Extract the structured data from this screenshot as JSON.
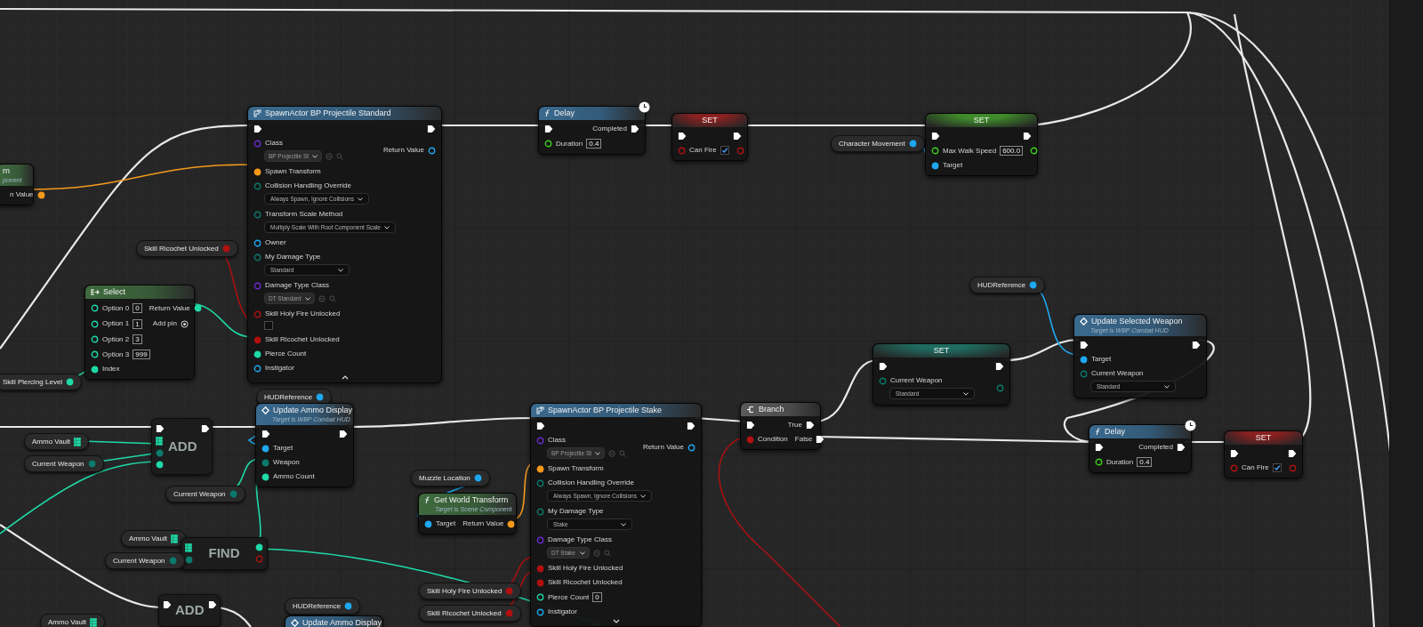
{
  "nodes": [
    {
      "kind": "fragment",
      "title": "rn",
      "subtitle": "ponent",
      "color": "#3f6b3f",
      "rows": [
        {
          "right": {
            "kind": "struct",
            "label": "n Value",
            "linked": true
          }
        }
      ]
    },
    {
      "kind": "spawn",
      "title": "SpawnActor BP Projectile Standard",
      "color": "#3a6a8f",
      "expanded": true,
      "rows": [
        {
          "left": {
            "kind": "exec",
            "linked": true
          },
          "right": {
            "kind": "exec",
            "linked": true
          }
        },
        {
          "left": {
            "kind": "class",
            "label": "Class",
            "linked": false,
            "dropdown": "BP Projectile St"
          },
          "right": {
            "kind": "object",
            "label": "Return Value",
            "linked": false
          }
        },
        {
          "left": {
            "kind": "struct",
            "label": "Spawn Transform",
            "linked": true
          }
        },
        {
          "left": {
            "kind": "byte",
            "label": "Collision Handling Override",
            "linked": false,
            "dropdown": "Always Spawn, Ignore Collisions"
          }
        },
        {
          "left": {
            "kind": "byte",
            "label": "Transform Scale Method",
            "linked": false,
            "dropdown": "Multiply Scale With Root Component Scale"
          }
        },
        {
          "left": {
            "kind": "object",
            "label": "Owner",
            "linked": false
          }
        },
        {
          "left": {
            "kind": "byte",
            "label": "My Damage Type",
            "linked": false,
            "dropdown": "Standard"
          }
        },
        {
          "left": {
            "kind": "class",
            "label": "Damage Type Class",
            "linked": false,
            "dropdown": "DT Standard"
          }
        },
        {
          "left": {
            "kind": "bool",
            "label": "Skill Holy Fire Unlocked",
            "linked": false,
            "checked": false
          }
        },
        {
          "left": {
            "kind": "bool",
            "label": "Skill Ricochet Unlocked",
            "linked": true
          }
        },
        {
          "left": {
            "kind": "int",
            "label": "Pierce Count",
            "linked": true
          }
        },
        {
          "left": {
            "kind": "object",
            "label": "Instigator",
            "linked": false
          }
        }
      ]
    },
    {
      "kind": "function",
      "title": "Delay",
      "color": "#3a6a8f",
      "latent": true,
      "rows": [
        {
          "left": {
            "kind": "exec",
            "linked": true
          },
          "right": {
            "kind": "exec",
            "label": "Completed",
            "linked": true
          }
        },
        {
          "left": {
            "kind": "float",
            "label": "Duration",
            "linked": false,
            "value": "0.4"
          }
        }
      ]
    },
    {
      "kind": "set",
      "title": "SET",
      "color": "#8a2020",
      "rows": [
        {
          "left": {
            "kind": "exec",
            "linked": true
          },
          "right": {
            "kind": "exec",
            "linked": true
          }
        },
        {
          "left": {
            "kind": "bool",
            "label": "Can Fire",
            "linked": false,
            "checked": true
          },
          "right": {
            "kind": "bool",
            "linked": false
          }
        }
      ]
    },
    {
      "kind": "getter",
      "label": "Character Movement",
      "pin": {
        "kind": "object",
        "linked": true
      }
    },
    {
      "kind": "set",
      "title": "SET",
      "color": "#3f8a2a",
      "rows": [
        {
          "left": {
            "kind": "exec",
            "linked": true
          },
          "right": {
            "kind": "exec",
            "linked": true
          }
        },
        {
          "left": {
            "kind": "float",
            "label": "Max Walk Speed",
            "linked": false,
            "value": "600.0"
          },
          "right": {
            "kind": "float",
            "linked": false
          }
        },
        {
          "left": {
            "kind": "object",
            "label": "Target",
            "linked": true
          }
        }
      ]
    },
    {
      "kind": "getter",
      "label": "Skill Ricochet Unlocked",
      "pin": {
        "kind": "bool",
        "linked": true
      }
    },
    {
      "kind": "getter",
      "label": "HUDReference",
      "pin": {
        "kind": "object",
        "linked": true
      }
    },
    {
      "kind": "select",
      "title": "Select",
      "color": "#3f6b3f",
      "rows": [
        {
          "left": {
            "kind": "int",
            "label": "Option 0",
            "linked": false,
            "value": "0"
          },
          "right": {
            "kind": "int",
            "label": "Return Value",
            "linked": true
          }
        },
        {
          "left": {
            "kind": "int",
            "label": "Option 1",
            "linked": false,
            "value": "1"
          },
          "right": {
            "kind": "add",
            "label": "Add pin"
          }
        },
        {
          "left": {
            "kind": "int",
            "label": "Option 2",
            "linked": false,
            "value": "3"
          }
        },
        {
          "left": {
            "kind": "int",
            "label": "Option 3",
            "linked": false,
            "value": "999"
          }
        },
        {
          "left": {
            "kind": "int",
            "label": "Index",
            "linked": true
          }
        }
      ]
    },
    {
      "kind": "getter",
      "label": "Skill Piercing Level",
      "pin": {
        "kind": "int",
        "linked": true
      }
    },
    {
      "kind": "set",
      "title": "SET",
      "color": "#1f6b5f",
      "rows": [
        {
          "left": {
            "kind": "exec",
            "linked": true
          },
          "right": {
            "kind": "exec",
            "linked": true
          }
        },
        {
          "left": {
            "kind": "byte",
            "label": "Current Weapon",
            "linked": false,
            "dropdown": "Standard"
          },
          "right": {
            "kind": "byte",
            "linked": false
          }
        }
      ]
    },
    {
      "kind": "event_call",
      "title": "Update Selected Weapon",
      "subtitle": "Target is WBP Combat HUD",
      "color": "#3a6a8f",
      "rows": [
        {
          "left": {
            "kind": "exec",
            "linked": true
          },
          "right": {
            "kind": "exec",
            "linked": true
          }
        },
        {
          "left": {
            "kind": "object",
            "label": "Target",
            "linked": true
          }
        },
        {
          "left": {
            "kind": "byte",
            "label": "Current Weapon",
            "linked": false,
            "dropdown": "Standard"
          }
        }
      ]
    },
    {
      "kind": "getter",
      "label": "HUDReference",
      "pin": {
        "kind": "object",
        "linked": true
      }
    },
    {
      "kind": "event_call",
      "title": "Update Ammo Display",
      "subtitle": "Target is WBP Combat HUD",
      "color": "#3a6a8f",
      "rows": [
        {
          "left": {
            "kind": "exec",
            "linked": true
          },
          "right": {
            "kind": "exec",
            "linked": true
          }
        },
        {
          "left": {
            "kind": "object",
            "label": "Target",
            "linked": true
          }
        },
        {
          "left": {
            "kind": "byte",
            "label": "Weapon",
            "linked": true
          }
        },
        {
          "left": {
            "kind": "int",
            "label": "Ammo Count",
            "linked": true
          }
        }
      ]
    },
    {
      "kind": "spawn",
      "title": "SpawnActor BP Projectile Stake",
      "color": "#3a6a8f",
      "expanded": false,
      "rows": [
        {
          "left": {
            "kind": "exec",
            "linked": true
          },
          "right": {
            "kind": "exec",
            "linked": true
          }
        },
        {
          "left": {
            "kind": "class",
            "label": "Class",
            "linked": false,
            "dropdown": "BP Projectile St"
          },
          "right": {
            "kind": "object",
            "label": "Return Value",
            "linked": false
          }
        },
        {
          "left": {
            "kind": "struct",
            "label": "Spawn Transform",
            "linked": true
          }
        },
        {
          "left": {
            "kind": "byte",
            "label": "Collision Handling Override",
            "linked": false,
            "dropdown": "Always Spawn, Ignore Collisions"
          }
        },
        {
          "left": {
            "kind": "byte",
            "label": "My Damage Type",
            "linked": false,
            "dropdown": "Stake"
          }
        },
        {
          "left": {
            "kind": "class",
            "label": "Damage Type Class",
            "linked": false,
            "dropdown": "DT Stake"
          }
        },
        {
          "left": {
            "kind": "bool",
            "label": "Skill Holy Fire Unlocked",
            "linked": true
          }
        },
        {
          "left": {
            "kind": "bool",
            "label": "Skill Ricochet Unlocked",
            "linked": true
          }
        },
        {
          "left": {
            "kind": "int",
            "label": "Pierce Count",
            "linked": false,
            "value": "0"
          }
        },
        {
          "left": {
            "kind": "object",
            "label": "Instigator",
            "linked": false
          }
        }
      ]
    },
    {
      "kind": "branch",
      "title": "Branch",
      "color": "#5a5a5a",
      "rows": [
        {
          "left": {
            "kind": "exec",
            "linked": true
          },
          "right": {
            "kind": "exec",
            "label": "True",
            "linked": true
          }
        },
        {
          "left": {
            "kind": "bool",
            "label": "Condition",
            "linked": true
          },
          "right": {
            "kind": "exec",
            "label": "False",
            "linked": true
          }
        }
      ]
    },
    {
      "kind": "compact",
      "title": "ADD",
      "rows": [
        {
          "left": {
            "kind": "exec",
            "linked": true
          },
          "right": {
            "kind": "exec",
            "linked": true
          }
        },
        {
          "left": {
            "kind": "map",
            "linked": true
          }
        },
        {
          "left": {
            "kind": "byte",
            "linked": true
          }
        },
        {
          "left": {
            "kind": "int",
            "linked": true
          }
        }
      ]
    },
    {
      "kind": "getter",
      "label": "Ammo Vault",
      "pin": {
        "kind": "map",
        "linked": true
      }
    },
    {
      "kind": "getter",
      "label": "Current Weapon",
      "pin": {
        "kind": "byte",
        "linked": true
      }
    },
    {
      "kind": "function",
      "title": "Delay",
      "color": "#3a6a8f",
      "latent": true,
      "rows": [
        {
          "left": {
            "kind": "exec",
            "linked": true
          },
          "right": {
            "kind": "exec",
            "label": "Completed",
            "linked": true
          }
        },
        {
          "left": {
            "kind": "float",
            "label": "Duration",
            "linked": false,
            "value": "0.4"
          }
        }
      ]
    },
    {
      "kind": "set",
      "title": "SET",
      "color": "#8a2020",
      "rows": [
        {
          "left": {
            "kind": "exec",
            "linked": true
          },
          "right": {
            "kind": "exec",
            "linked": true
          }
        },
        {
          "left": {
            "kind": "bool",
            "label": "Can Fire",
            "linked": false,
            "checked": true
          },
          "right": {
            "kind": "bool",
            "linked": false
          }
        }
      ]
    },
    {
      "kind": "getter",
      "label": "Muzzle Location",
      "pin": {
        "kind": "object",
        "linked": true
      }
    },
    {
      "kind": "getter",
      "label": "Current Weapon",
      "pin": {
        "kind": "byte",
        "linked": true
      }
    },
    {
      "kind": "function",
      "title": "Get World Transform",
      "subtitle": "Target is Scene Component",
      "color": "#3f6b3f",
      "rows": [
        {
          "left": {
            "kind": "object",
            "label": "Target",
            "linked": true
          },
          "right": {
            "kind": "struct",
            "label": "Return Value",
            "linked": true
          }
        }
      ]
    },
    {
      "kind": "getter",
      "label": "Ammo Vault",
      "pin": {
        "kind": "map",
        "linked": true
      }
    },
    {
      "kind": "compact",
      "title": "FIND",
      "rows": [
        {
          "left": {
            "kind": "map",
            "linked": true
          },
          "right": {
            "kind": "int",
            "linked": true
          }
        },
        {
          "left": {
            "kind": "byte",
            "linked": true
          },
          "right": {
            "kind": "bool",
            "linked": false
          }
        }
      ]
    },
    {
      "kind": "getter",
      "label": "Current Weapon",
      "pin": {
        "kind": "byte",
        "linked": true
      }
    },
    {
      "kind": "getter",
      "label": "Skill Holy Fire Unlocked",
      "pin": {
        "kind": "bool",
        "linked": true
      }
    },
    {
      "kind": "compact",
      "title": "ADD",
      "rows": [
        {
          "left": {
            "kind": "exec",
            "linked": true
          },
          "right": {
            "kind": "exec",
            "linked": true
          }
        }
      ]
    },
    {
      "kind": "getter",
      "label": "HUDReference",
      "pin": {
        "kind": "object",
        "linked": true
      }
    },
    {
      "kind": "getter",
      "label": "Skill Ricochet Unlocked",
      "pin": {
        "kind": "bool",
        "linked": true
      }
    },
    {
      "kind": "getter",
      "label": "Ammo Vault",
      "pin": {
        "kind": "map",
        "linked": true
      }
    },
    {
      "kind": "event_call",
      "title": "Update Ammo Display",
      "color": "#3a6a8f"
    }
  ]
}
